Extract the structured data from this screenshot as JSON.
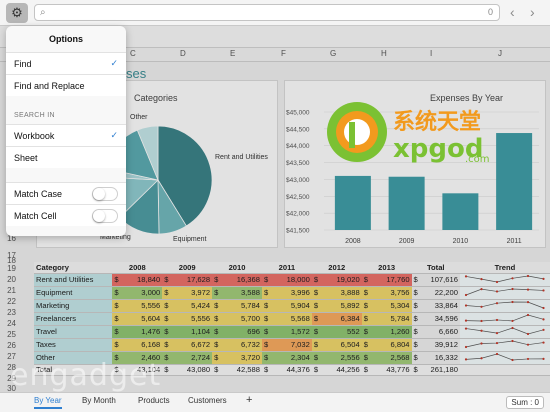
{
  "search": {
    "placeholder": "",
    "count": "0"
  },
  "columns": [
    "C",
    "D",
    "E",
    "F",
    "G",
    "H",
    "I",
    "J"
  ],
  "rows": {
    "visible_numbers": [
      "16",
      "17",
      "18",
      "19",
      "20",
      "21",
      "22",
      "23",
      "24",
      "25",
      "26",
      "27",
      "28",
      "29",
      "30"
    ]
  },
  "sheet_title_fragment": "ses",
  "charts": {
    "pie": {
      "title": "Categories",
      "labels": [
        "Other",
        "Rent and Utilities",
        "Equipment",
        "Marketing"
      ]
    },
    "bar": {
      "title": "Expenses By Year",
      "y_ticks": [
        "$45,000",
        "$44,500",
        "$44,000",
        "$43,500",
        "$43,000",
        "$42,500",
        "$42,000",
        "$41,500"
      ],
      "categories": [
        "2008",
        "2009",
        "2010",
        "2011"
      ]
    }
  },
  "chart_data": [
    {
      "type": "pie",
      "title": "Categories",
      "categories": [
        "Rent and Utilities",
        "Equipment",
        "Marketing",
        "Freelancers",
        "Travel",
        "Taxes",
        "Other"
      ],
      "values": [
        107616,
        22200,
        33864,
        34596,
        6660,
        39912,
        16332
      ]
    },
    {
      "type": "bar",
      "title": "Expenses By Year",
      "categories": [
        "2008",
        "2009",
        "2010",
        "2011"
      ],
      "values": [
        43104,
        43080,
        42588,
        44376
      ],
      "ylim": [
        41500,
        45000
      ],
      "color": "#3e9aa3"
    }
  ],
  "table": {
    "headers": [
      "Category",
      "2008",
      "2009",
      "2010",
      "2011",
      "2012",
      "2013",
      "Total",
      "Trend"
    ],
    "currency": "$",
    "rows": [
      [
        "Rent and Utilities",
        "18,840",
        "17,628",
        "16,368",
        "18,000",
        "19,020",
        "17,760",
        "107,616"
      ],
      [
        "Equipment",
        "3,000",
        "3,972",
        "3,588",
        "3,996",
        "3,888",
        "3,756",
        "22,200"
      ],
      [
        "Marketing",
        "5,556",
        "5,424",
        "5,784",
        "5,904",
        "5,892",
        "5,304",
        "33,864"
      ],
      [
        "Freelancers",
        "5,604",
        "5,556",
        "5,700",
        "5,568",
        "6,384",
        "5,784",
        "34,596"
      ],
      [
        "Travel",
        "1,476",
        "1,104",
        "696",
        "1,572",
        "552",
        "1,260",
        "6,660"
      ],
      [
        "Taxes",
        "6,168",
        "6,672",
        "6,732",
        "7,032",
        "6,504",
        "6,804",
        "39,912"
      ],
      [
        "Other",
        "2,460",
        "2,724",
        "3,720",
        "2,304",
        "2,556",
        "2,568",
        "16,332"
      ],
      [
        "Total",
        "43,104",
        "43,080",
        "42,588",
        "44,376",
        "44,256",
        "43,776",
        "261,180"
      ]
    ]
  },
  "options": {
    "title": "Options",
    "find": "Find",
    "find_replace": "Find and Replace",
    "search_in": "SEARCH IN",
    "workbook": "Workbook",
    "sheet": "Sheet",
    "match_case": "Match Case",
    "match_cell": "Match Cell",
    "checkmark": "✓"
  },
  "tabs": [
    "By Year",
    "By Month",
    "Products",
    "Customers"
  ],
  "add_tab": "+",
  "sum": "Sum : 0",
  "watermarks": {
    "site_cn": "系统天堂",
    "site": "xpgod",
    "site_tld": ".com",
    "engadget": "engadget"
  },
  "colors": {
    "accent": "#2f7fd0",
    "teal": "#3e9aa3",
    "logo_green": "#7bc133",
    "logo_orange": "#f29a1e"
  }
}
